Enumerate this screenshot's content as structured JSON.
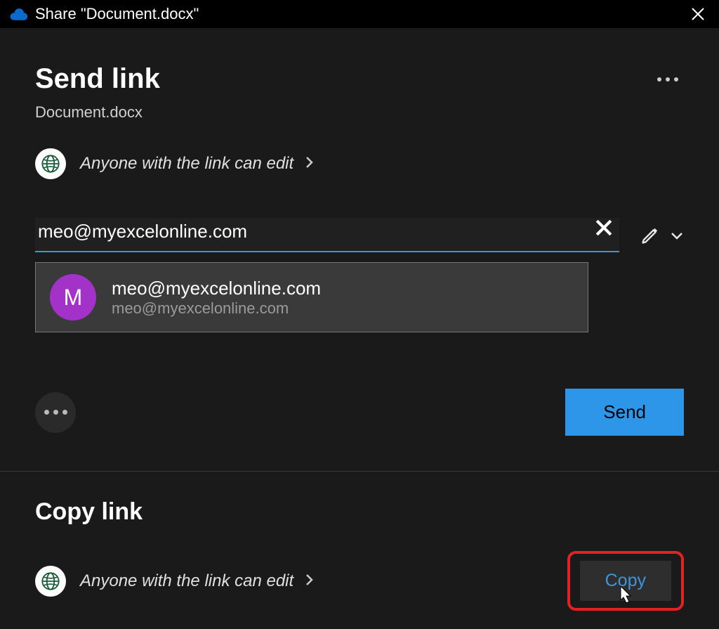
{
  "titleBar": {
    "text": "Share \"Document.docx\""
  },
  "header": {
    "title": "Send link",
    "documentName": "Document.docx"
  },
  "permission": {
    "text": "Anyone with the link can edit"
  },
  "emailInput": {
    "value": "meo@myexcelonline.com"
  },
  "suggestion": {
    "avatarLetter": "M",
    "primary": "meo@myexcelonline.com",
    "secondary": "meo@myexcelonline.com"
  },
  "buttons": {
    "send": "Send",
    "copy": "Copy"
  },
  "copyLink": {
    "title": "Copy link",
    "permissionText": "Anyone with the link can edit"
  }
}
